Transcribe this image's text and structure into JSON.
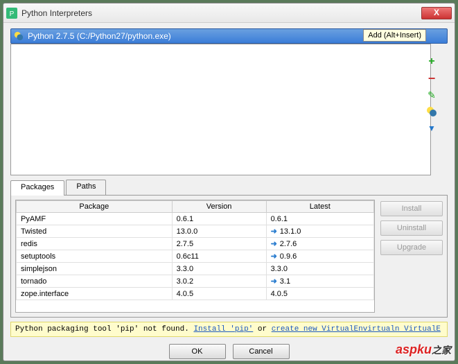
{
  "window": {
    "title": "Python Interpreters",
    "close": "X"
  },
  "interpreter": {
    "label": "Python 2.7.5 (C:/Python27/python.exe)"
  },
  "tooltip": {
    "add": "Add (Alt+Insert)"
  },
  "side": {
    "add": "+",
    "remove": "−",
    "edit": "✎",
    "python": "🐍",
    "filter": "▼"
  },
  "tabs": {
    "packages": "Packages",
    "paths": "Paths"
  },
  "table": {
    "headers": {
      "package": "Package",
      "version": "Version",
      "latest": "Latest"
    },
    "rows": [
      {
        "pkg": "PyAMF",
        "ver": "0.6.1",
        "latest": "0.6.1",
        "arrow": false
      },
      {
        "pkg": "Twisted",
        "ver": "13.0.0",
        "latest": "13.1.0",
        "arrow": true
      },
      {
        "pkg": "redis",
        "ver": "2.7.5",
        "latest": "2.7.6",
        "arrow": true
      },
      {
        "pkg": "setuptools",
        "ver": "0.6c11",
        "latest": "0.9.6",
        "arrow": true
      },
      {
        "pkg": "simplejson",
        "ver": "3.3.0",
        "latest": "3.3.0",
        "arrow": false
      },
      {
        "pkg": "tornado",
        "ver": "3.0.2",
        "latest": "3.1",
        "arrow": true
      },
      {
        "pkg": "zope.interface",
        "ver": "4.0.5",
        "latest": "4.0.5",
        "arrow": false
      }
    ]
  },
  "pkg_buttons": {
    "install": "Install",
    "uninstall": "Uninstall",
    "upgrade": "Upgrade"
  },
  "message": {
    "prefix": "Python packaging tool 'pip' not found. ",
    "link1": "Install 'pip'",
    "mid": " or ",
    "link2": "create new VirtualEnvirtualn VirtualE"
  },
  "dialog": {
    "ok": "OK",
    "cancel": "Cancel"
  },
  "watermark": {
    "main": "aspku",
    "sub": "之家"
  }
}
